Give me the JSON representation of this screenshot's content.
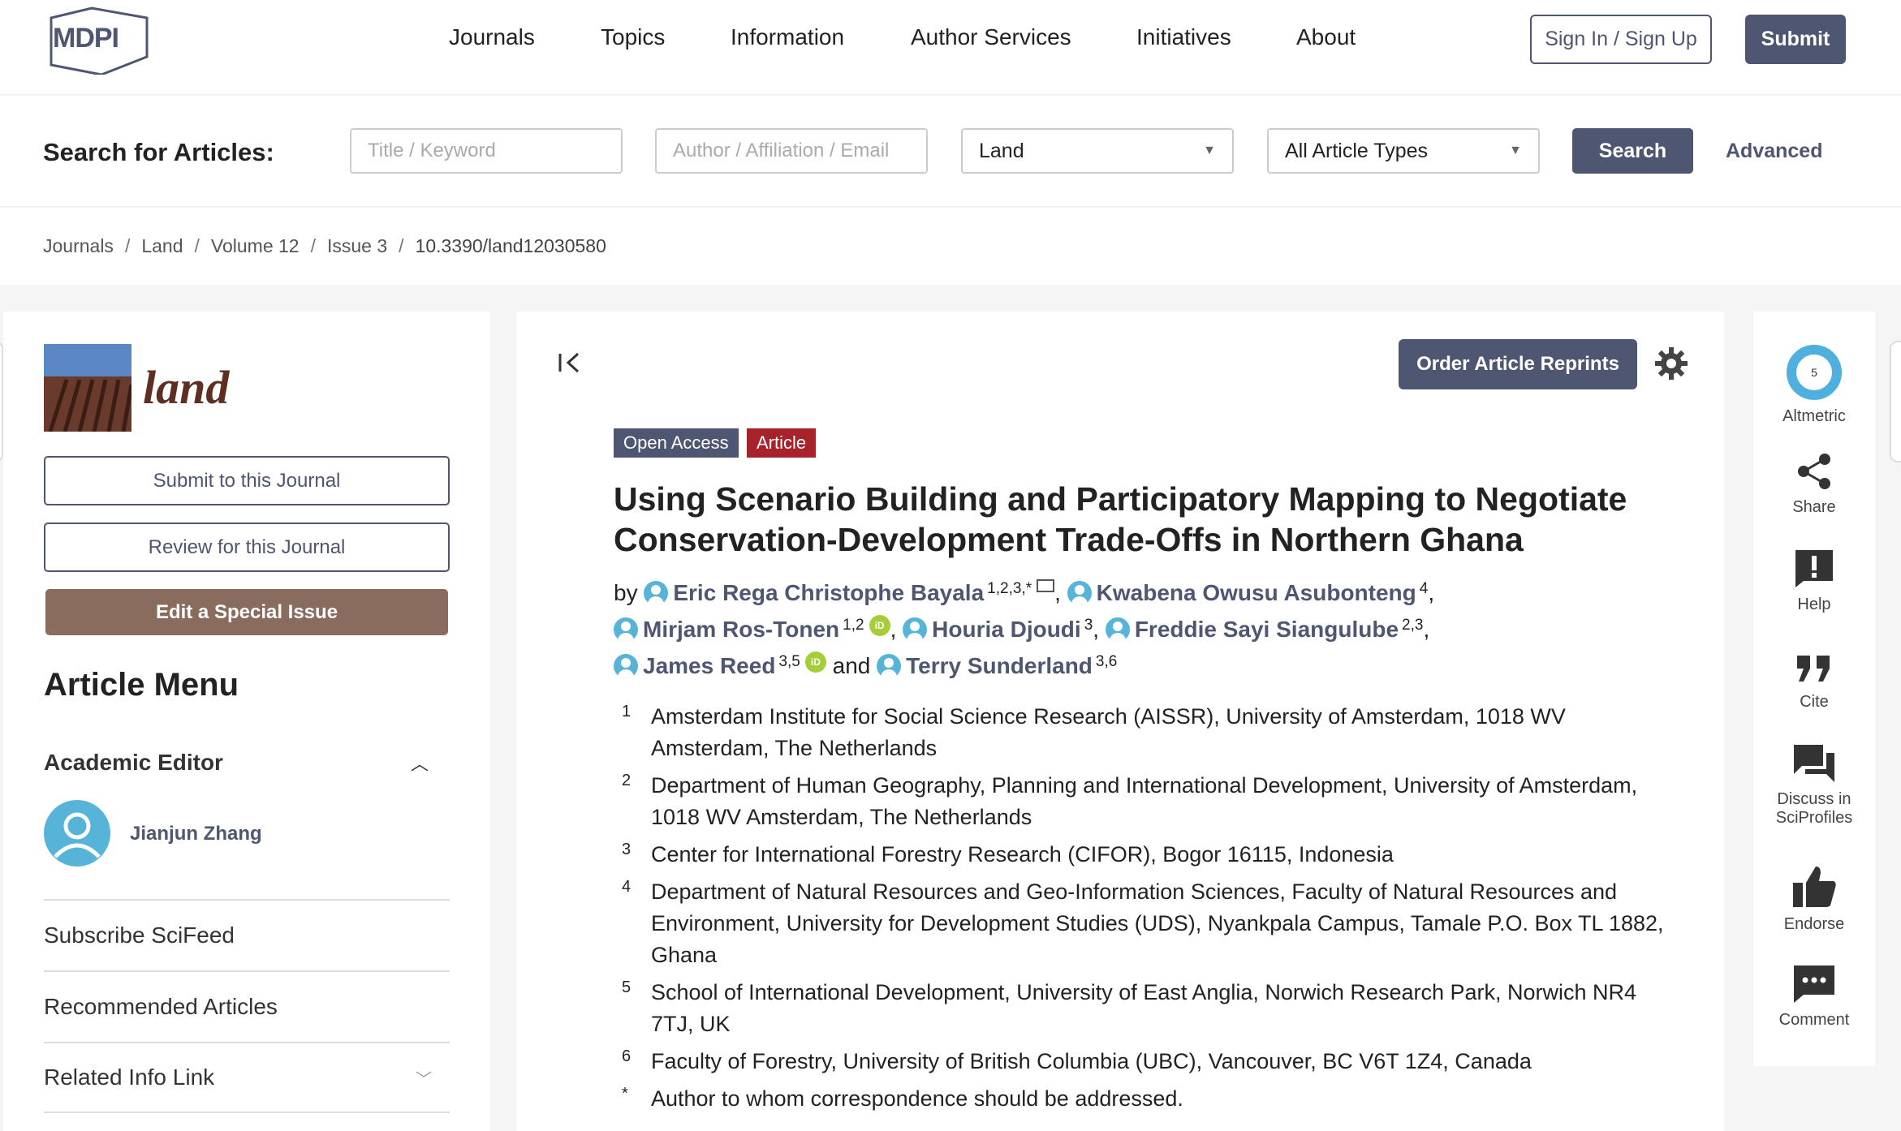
{
  "header": {
    "logo": "MDPI",
    "nav": [
      "Journals",
      "Topics",
      "Information",
      "Author Services",
      "Initiatives",
      "About"
    ],
    "sign_in": "Sign In / Sign Up",
    "submit": "Submit"
  },
  "search": {
    "label": "Search for Articles:",
    "title_placeholder": "Title / Keyword",
    "author_placeholder": "Author / Affiliation / Email",
    "journal_value": "Land",
    "type_value": "All Article Types",
    "button": "Search",
    "advanced": "Advanced"
  },
  "breadcrumb": [
    "Journals",
    "Land",
    "Volume 12",
    "Issue 3",
    "10.3390/land12030580"
  ],
  "sidebar": {
    "journal_name": "land",
    "submit_btn": "Submit to this Journal",
    "review_btn": "Review for this Journal",
    "special_btn": "Edit a Special Issue",
    "menu_title": "Article Menu",
    "academic_editor_label": "Academic Editor",
    "editor_name": "Jianjun Zhang",
    "links": [
      "Subscribe SciFeed",
      "Recommended Articles",
      "Related Info Link"
    ]
  },
  "article": {
    "reprints_btn": "Order Article Reprints",
    "badge_open": "Open Access",
    "badge_type": "Article",
    "title": "Using Scenario Building and Participatory Mapping to Negotiate Conservation-Development Trade-Offs in Northern Ghana",
    "by": "by",
    "and": "and",
    "authors": [
      {
        "name": "Eric Rega Christophe Bayala",
        "sup": "1,2,3,*"
      },
      {
        "name": "Kwabena Owusu Asubonteng",
        "sup": "4"
      },
      {
        "name": "Mirjam Ros-Tonen",
        "sup": "1,2"
      },
      {
        "name": "Houria Djoudi",
        "sup": "3"
      },
      {
        "name": "Freddie Sayi Siangulube",
        "sup": "2,3"
      },
      {
        "name": "James Reed",
        "sup": "3,5"
      },
      {
        "name": "Terry Sunderland",
        "sup": "3,6"
      }
    ],
    "affiliations": [
      {
        "num": "1",
        "text": "Amsterdam Institute for Social Science Research (AISSR), University of Amsterdam, 1018 WV Amsterdam, The Netherlands"
      },
      {
        "num": "2",
        "text": "Department of Human Geography, Planning and International Development, University of Amsterdam, 1018 WV Amsterdam, The Netherlands"
      },
      {
        "num": "3",
        "text": "Center for International Forestry Research (CIFOR), Bogor 16115, Indonesia"
      },
      {
        "num": "4",
        "text": "Department of Natural Resources and Geo-Information Sciences, Faculty of Natural Resources and Environment, University for Development Studies (UDS), Nyankpala Campus, Tamale P.O. Box TL 1882, Ghana"
      },
      {
        "num": "5",
        "text": "School of International Development, University of East Anglia, Norwich Research Park, Norwich NR4 7TJ, UK"
      },
      {
        "num": "6",
        "text": "Faculty of Forestry, University of British Columbia (UBC), Vancouver, BC V6T 1Z4, Canada"
      },
      {
        "num": "*",
        "text": "Author to whom correspondence should be addressed."
      }
    ]
  },
  "rail": {
    "altmetric_score": "5",
    "altmetric": "Altmetric",
    "share": "Share",
    "help": "Help",
    "cite": "Cite",
    "discuss_1": "Discuss in",
    "discuss_2": "SciProfiles",
    "endorse": "Endorse",
    "comment": "Comment"
  },
  "colors": {
    "brand": "#4f5671",
    "article_badge": "#a6232c",
    "special_issue": "#8a6c5e",
    "author_icon": "#56b4d8",
    "orcid": "#a6ce39"
  }
}
